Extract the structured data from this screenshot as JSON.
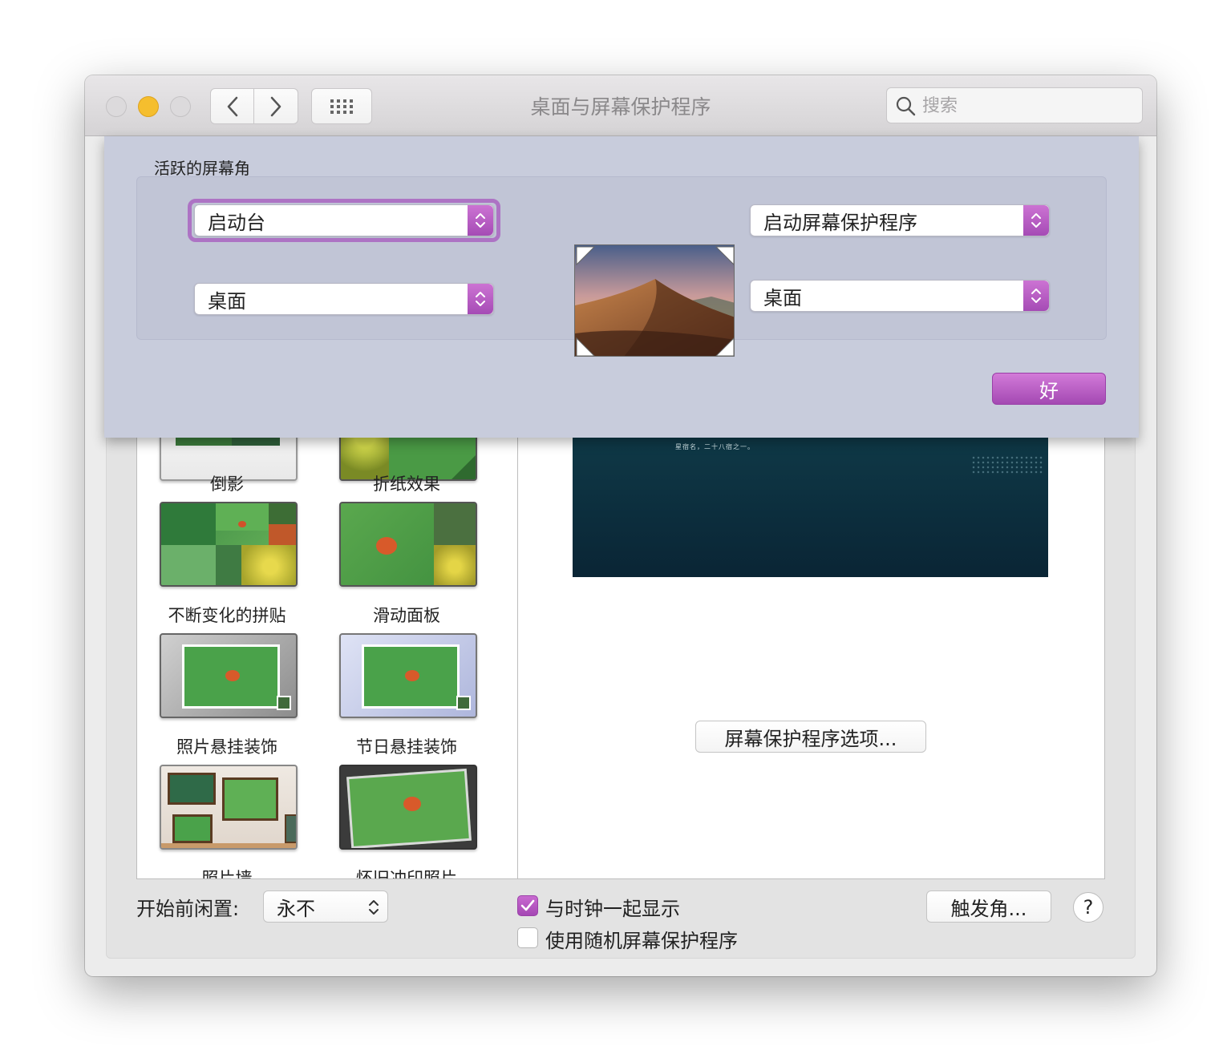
{
  "window": {
    "title": "桌面与屏幕保护程序"
  },
  "search": {
    "placeholder": "搜索"
  },
  "sheet": {
    "title": "活跃的屏幕角",
    "top_left": "启动台",
    "top_right": "启动屏幕保护程序",
    "bottom_left": "桌面",
    "bottom_right": "桌面",
    "ok_label": "好"
  },
  "screensavers": [
    {
      "label": "倒影"
    },
    {
      "label": "折纸效果"
    },
    {
      "label": "不断变化的拼贴"
    },
    {
      "label": "滑动面板"
    },
    {
      "label": "照片悬挂装饰"
    },
    {
      "label": "节日悬挂装饰"
    },
    {
      "label": "照片墙"
    },
    {
      "label": "怀旧冲印照片"
    }
  ],
  "preview": {
    "caption": "星宿名，二十八宿之一。"
  },
  "options_button": "屏幕保护程序选项...",
  "idle": {
    "label": "开始前闲置:",
    "value": "永不"
  },
  "show_clock": {
    "label": "与时钟一起显示",
    "checked": true
  },
  "random_saver": {
    "label": "使用随机屏幕保护程序",
    "checked": false
  },
  "hot_corners_button": "触发角...",
  "help_label": "?",
  "colors": {
    "accent": "#b055c0",
    "sheet_bg": "#c8ccdc",
    "minimize": "#f5be2e"
  }
}
